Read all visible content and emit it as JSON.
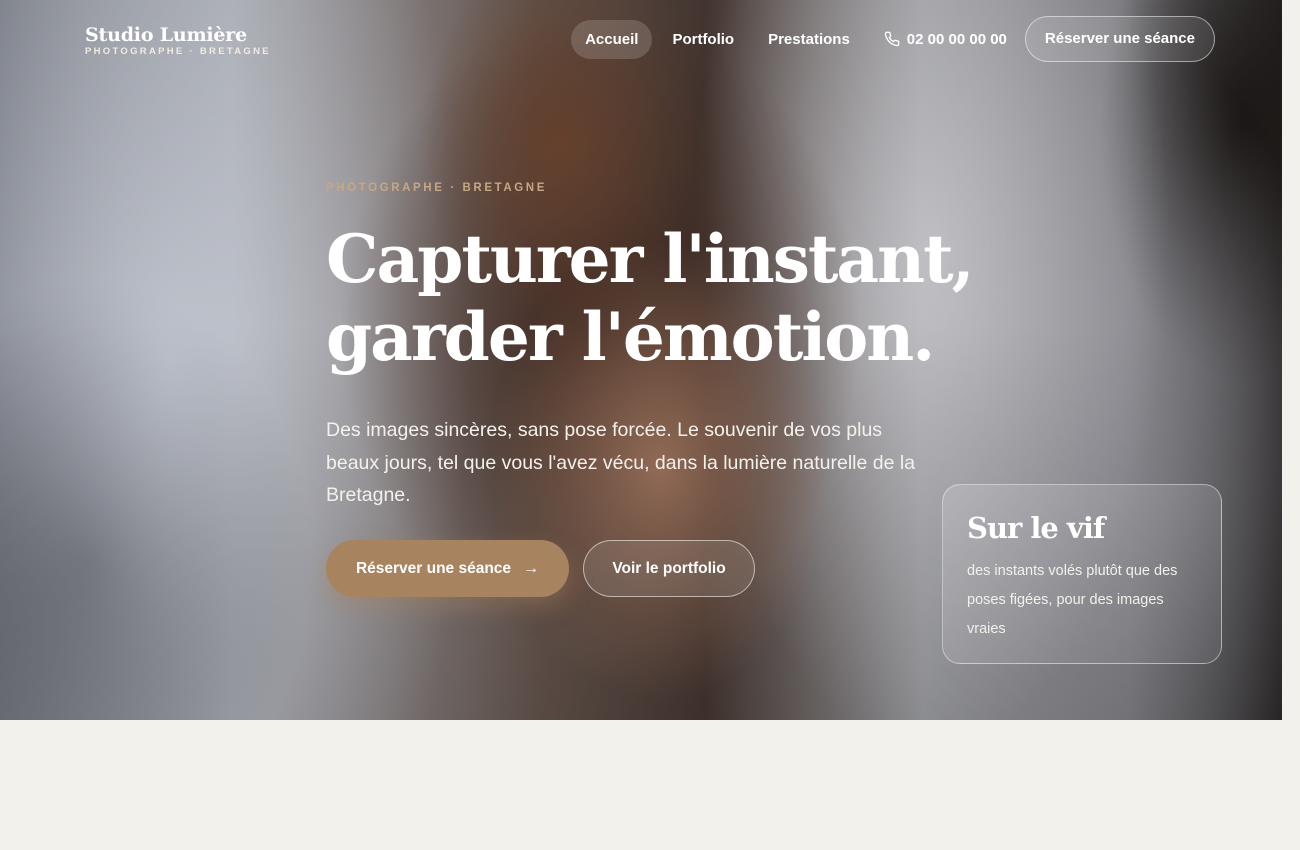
{
  "brand": {
    "name": "Studio Lumière",
    "tagline": "PHOTOGRAPHE · BRETAGNE"
  },
  "nav": {
    "items": [
      {
        "label": "Accueil",
        "active": true
      },
      {
        "label": "Portfolio",
        "active": false
      },
      {
        "label": "Prestations",
        "active": false
      }
    ],
    "phone": "02 00 00 00 00",
    "phone_icon": "phone-icon",
    "cta": "Réserver une séance"
  },
  "hero": {
    "eyebrow": "PHOTOGRAPHE · BRETAGNE",
    "headline_line1": "Capturer l'instant,",
    "headline_line2": "garder l'émotion.",
    "lead": "Des images sincères, sans pose forcée. Le souvenir de vos plus beaux jours, tel que vous l'avez vécu, dans la lumière naturelle de la Bretagne.",
    "primary_button": "Réserver une séance",
    "primary_button_icon": "arrow-right-icon",
    "secondary_button": "Voir le portfolio"
  },
  "card": {
    "title": "Sur le vif",
    "text": "des instants volés plutôt que des poses figées, pour des images vraies"
  },
  "colors": {
    "accent": "#a7835f",
    "eyebrow": "#c6a785",
    "page_background": "#f3f1ec"
  }
}
